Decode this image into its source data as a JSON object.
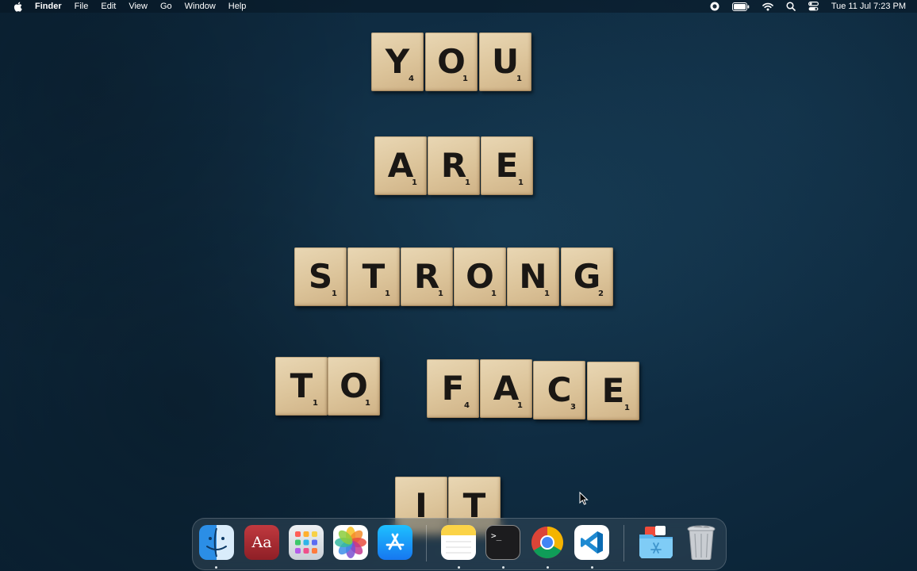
{
  "menubar": {
    "apple_icon": "apple-logo-icon",
    "app_name": "Finder",
    "items": [
      "File",
      "Edit",
      "View",
      "Go",
      "Window",
      "Help"
    ],
    "tray": {
      "icons": [
        "screen-record-icon",
        "battery-icon",
        "wifi-icon",
        "spotlight-search-icon",
        "control-center-icon"
      ],
      "clock": "Tue 11 Jul  7:23 PM"
    }
  },
  "wallpaper": {
    "tiles": [
      {
        "letter": "Y",
        "score": "4"
      },
      {
        "letter": "O",
        "score": "1"
      },
      {
        "letter": "U",
        "score": "1"
      },
      {
        "letter": "A",
        "score": "1"
      },
      {
        "letter": "R",
        "score": "1"
      },
      {
        "letter": "E",
        "score": "1"
      },
      {
        "letter": "S",
        "score": "1"
      },
      {
        "letter": "T",
        "score": "1"
      },
      {
        "letter": "R",
        "score": "1"
      },
      {
        "letter": "O",
        "score": "1"
      },
      {
        "letter": "N",
        "score": "1"
      },
      {
        "letter": "G",
        "score": "2"
      },
      {
        "letter": "T",
        "score": "1"
      },
      {
        "letter": "O",
        "score": "1"
      },
      {
        "letter": "F",
        "score": "4"
      },
      {
        "letter": "A",
        "score": "1"
      },
      {
        "letter": "C",
        "score": "3"
      },
      {
        "letter": "E",
        "score": "1"
      },
      {
        "letter": "I",
        "score": ""
      },
      {
        "letter": "T",
        "score": ""
      }
    ]
  },
  "dock": {
    "apps": [
      {
        "name": "Finder",
        "icon": "finder-icon",
        "running": true
      },
      {
        "name": "Dictionary",
        "icon": "dictionary-icon",
        "label": "Aa",
        "running": false
      },
      {
        "name": "Launchpad",
        "icon": "launchpad-icon",
        "running": false
      },
      {
        "name": "Photos",
        "icon": "photos-icon",
        "running": false
      },
      {
        "name": "App Store",
        "icon": "app-store-icon",
        "running": false
      },
      {
        "name": "Notes",
        "icon": "notes-icon",
        "running": true
      },
      {
        "name": "Terminal",
        "icon": "terminal-icon",
        "label": ">_",
        "running": true
      },
      {
        "name": "Google Chrome",
        "icon": "chrome-icon",
        "running": true
      },
      {
        "name": "Visual Studio Code",
        "icon": "vscode-icon",
        "running": true
      },
      {
        "name": "Applications",
        "icon": "applications-folder-icon",
        "running": false
      },
      {
        "name": "Trash",
        "icon": "trash-icon",
        "running": false
      }
    ]
  },
  "colors": {
    "wallpaper": "#0f2c42",
    "tile": "#dcc49a",
    "tile_text": "#1a1714"
  }
}
